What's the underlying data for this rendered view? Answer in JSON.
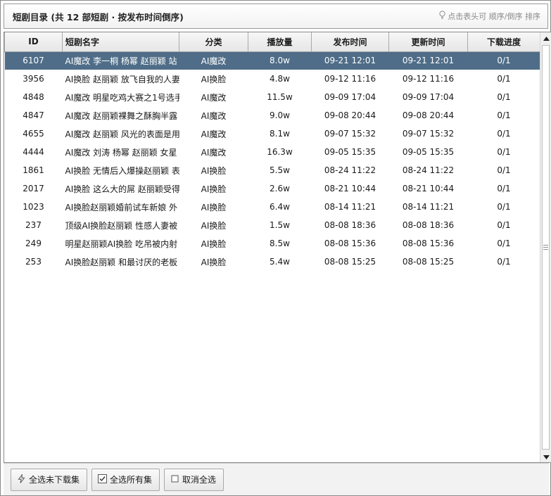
{
  "header": {
    "title": "短剧目录 (共 12 部短剧 · 按发布时间倒序)",
    "hint": "点击表头可 顺序/倒序 排序"
  },
  "table": {
    "columns": [
      "ID",
      "短剧名字",
      "分类",
      "播放量",
      "发布时间",
      "更新时间",
      "下载进度"
    ],
    "rows": [
      {
        "id": "6107",
        "name": "AI魔改 李一桐 杨幂 赵丽颖 站",
        "category": "AI魔改",
        "plays": "8.0w",
        "published": "09-21 12:01",
        "updated": "09-21 12:01",
        "progress": "0/1",
        "selected": true
      },
      {
        "id": "3956",
        "name": "AI换脸 赵丽颖 放飞自我的人妻",
        "category": "AI换脸",
        "plays": "4.8w",
        "published": "09-12 11:16",
        "updated": "09-12 11:16",
        "progress": "0/1",
        "selected": false
      },
      {
        "id": "4848",
        "name": "AI魔改 明星吃鸡大赛之1号选手",
        "category": "AI魔改",
        "plays": "11.5w",
        "published": "09-09 17:04",
        "updated": "09-09 17:04",
        "progress": "0/1",
        "selected": false
      },
      {
        "id": "4847",
        "name": "AI魔改 赵丽颖裸舞之酥胸半露",
        "category": "AI魔改",
        "plays": "9.0w",
        "published": "09-08 20:44",
        "updated": "09-08 20:44",
        "progress": "0/1",
        "selected": false
      },
      {
        "id": "4655",
        "name": "AI魔改 赵丽颖 风光的表面是用",
        "category": "AI魔改",
        "plays": "8.1w",
        "published": "09-07 15:32",
        "updated": "09-07 15:32",
        "progress": "0/1",
        "selected": false
      },
      {
        "id": "4444",
        "name": "AI魔改 刘涛 杨幂 赵丽颖 女星",
        "category": "AI魔改",
        "plays": "16.3w",
        "published": "09-05 15:35",
        "updated": "09-05 15:35",
        "progress": "0/1",
        "selected": false
      },
      {
        "id": "1861",
        "name": "AI换脸 无情后入爆操赵丽颖 表",
        "category": "AI换脸",
        "plays": "5.5w",
        "published": "08-24 11:22",
        "updated": "08-24 11:22",
        "progress": "0/1",
        "selected": false
      },
      {
        "id": "2017",
        "name": "AI换脸 这么大的屌 赵丽颖受得",
        "category": "AI换脸",
        "plays": "2.6w",
        "published": "08-21 10:44",
        "updated": "08-21 10:44",
        "progress": "0/1",
        "selected": false
      },
      {
        "id": "1023",
        "name": "AI换脸赵丽颖婚前试车新娘 外",
        "category": "AI换脸",
        "plays": "6.4w",
        "published": "08-14 11:21",
        "updated": "08-14 11:21",
        "progress": "0/1",
        "selected": false
      },
      {
        "id": "237",
        "name": "顶级AI换脸赵丽颖 性感人妻被",
        "category": "AI换脸",
        "plays": "1.5w",
        "published": "08-08 18:36",
        "updated": "08-08 18:36",
        "progress": "0/1",
        "selected": false
      },
      {
        "id": "249",
        "name": "明星赵丽颖AI换脸 吃吊被内射",
        "category": "AI换脸",
        "plays": "8.5w",
        "published": "08-08 15:36",
        "updated": "08-08 15:36",
        "progress": "0/1",
        "selected": false
      },
      {
        "id": "253",
        "name": "AI换脸赵丽颖 和最讨厌的老板",
        "category": "AI换脸",
        "plays": "5.4w",
        "published": "08-08 15:25",
        "updated": "08-08 15:25",
        "progress": "0/1",
        "selected": false
      }
    ]
  },
  "footer": {
    "select_undownloaded": "全选未下载集",
    "select_all": "全选所有集",
    "deselect_all": "取消全选"
  },
  "colors": {
    "selected_row": "#4f6d88",
    "selected_text": "#ffffff"
  },
  "icons": {
    "hint": "lightbulb-icon",
    "select_undownloaded": "lightning-icon",
    "select_all": "checkbox-checked-icon",
    "deselect_all": "checkbox-empty-icon"
  }
}
